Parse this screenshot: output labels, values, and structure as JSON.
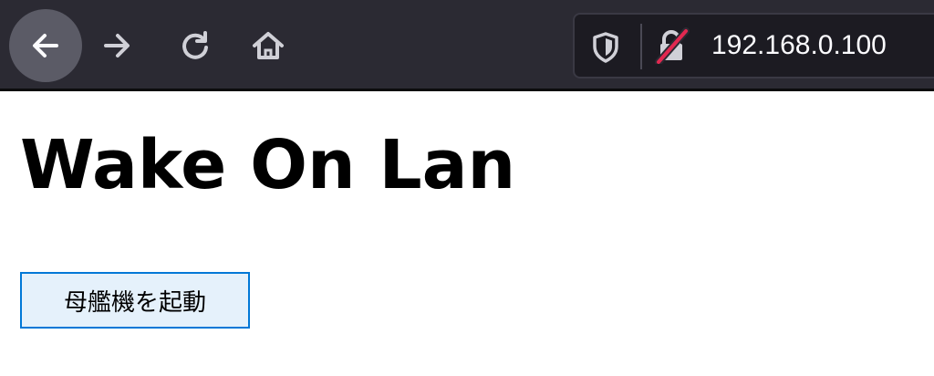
{
  "browser": {
    "url": "192.168.0.100",
    "icons": {
      "back": "back-arrow-icon",
      "forward": "forward-arrow-icon",
      "reload": "reload-icon",
      "home": "home-icon",
      "tracking": "shield-icon",
      "security": "insecure-lock-icon"
    }
  },
  "page": {
    "title": "Wake On Lan",
    "button_label": "母艦機を起動"
  },
  "colors": {
    "toolbar": "#2b2a33",
    "urlbar": "#1c1b22",
    "button_bg": "#e5f1fb",
    "button_border": "#0078d7",
    "insecure_slash": "#e22850"
  }
}
